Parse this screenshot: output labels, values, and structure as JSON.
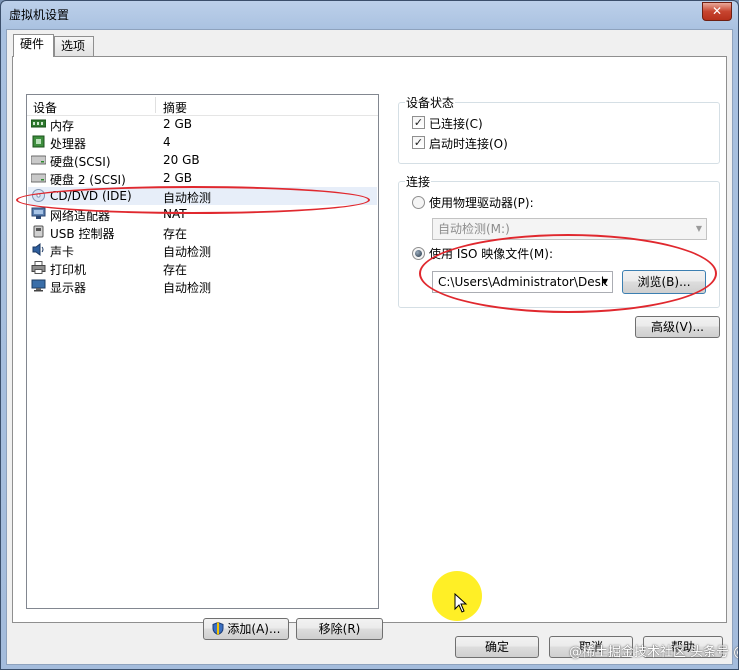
{
  "window": {
    "title": "虚拟机设置",
    "close_glyph": "✕"
  },
  "tabs": [
    {
      "label": "硬件",
      "active": true
    },
    {
      "label": "选项",
      "active": false
    }
  ],
  "device_list": {
    "headers": {
      "device": "设备",
      "summary": "摘要"
    },
    "rows": [
      {
        "name": "内存",
        "summary": "2 GB",
        "icon": "memory-icon"
      },
      {
        "name": "处理器",
        "summary": "4",
        "icon": "processor-icon"
      },
      {
        "name": "硬盘(SCSI)",
        "summary": "20 GB",
        "icon": "hard-disk-icon"
      },
      {
        "name": "硬盘 2 (SCSI)",
        "summary": "2 GB",
        "icon": "hard-disk-icon"
      },
      {
        "name": "CD/DVD (IDE)",
        "summary": "自动检测",
        "icon": "cd-dvd-icon",
        "selected": true
      },
      {
        "name": "网络适配器",
        "summary": "NAT",
        "icon": "network-adapter-icon"
      },
      {
        "name": "USB 控制器",
        "summary": "存在",
        "icon": "usb-icon"
      },
      {
        "name": "声卡",
        "summary": "自动检测",
        "icon": "sound-card-icon"
      },
      {
        "name": "打印机",
        "summary": "存在",
        "icon": "printer-icon"
      },
      {
        "name": "显示器",
        "summary": "自动检测",
        "icon": "display-icon"
      }
    ],
    "add_button": "添加(A)...",
    "remove_button": "移除(R)"
  },
  "device_status": {
    "title": "设备状态",
    "connected": {
      "label": "已连接(C)",
      "checked": true
    },
    "connect_at_power_on": {
      "label": "启动时连接(O)",
      "checked": true
    }
  },
  "connection": {
    "title": "连接",
    "physical_drive": {
      "label": "使用物理驱动器(P):",
      "selected": false
    },
    "physical_drive_value": "自动检测(M:)",
    "iso_image": {
      "label": "使用 ISO 映像文件(M):",
      "selected": true
    },
    "iso_path": "C:\\Users\\Administrator\\Desk",
    "browse_button": "浏览(B)...",
    "advanced_button": "高级(V)..."
  },
  "footer": {
    "ok_button": "确定",
    "cancel_button": "取消",
    "help_button": "帮助"
  },
  "watermark": "@稀土掘金技术社区 头条号 @yzhenfeng",
  "colors": {
    "annotation": "#e0282e",
    "cursor_highlight": "#ffec00",
    "selection": "#e7eef9"
  }
}
